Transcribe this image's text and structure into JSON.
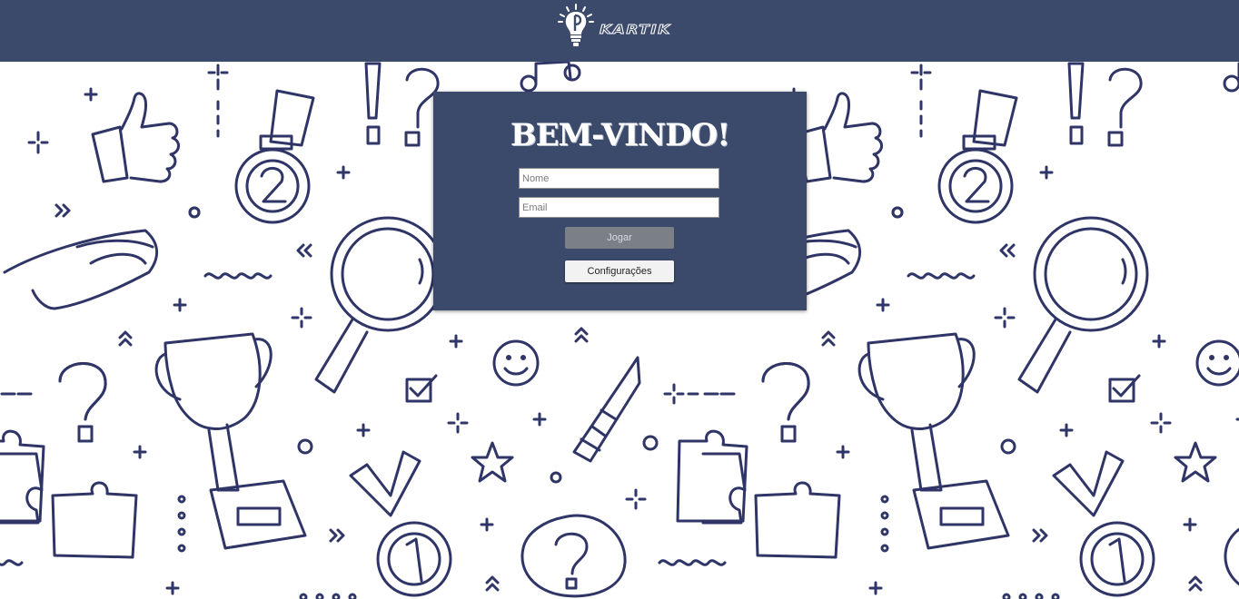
{
  "header": {
    "logo_text": "KARTIK",
    "background_color": "#3b4a6b"
  },
  "background": {
    "pattern_color": "#2f3566",
    "icons": [
      "question-mark-icon",
      "thumbs-up-icon",
      "medal-icon",
      "magnifying-glass-icon",
      "glasses-icon",
      "trophy-icon",
      "pencil-icon",
      "puzzle-piece-icon",
      "smiley-icon",
      "checkbox-icon",
      "star-icon",
      "lightbulb-icon",
      "speech-bubble-icon",
      "music-note-icon",
      "plus-icon"
    ]
  },
  "login": {
    "title": "BEM-VINDO!",
    "name_placeholder": "Nome",
    "name_value": "",
    "email_placeholder": "Email",
    "email_value": "",
    "play_label": "Jogar",
    "settings_label": "Configurações"
  },
  "colors": {
    "card": "#3b4a6b",
    "play_button": "#7b7f86",
    "settings_button": "#f2f2f2"
  }
}
